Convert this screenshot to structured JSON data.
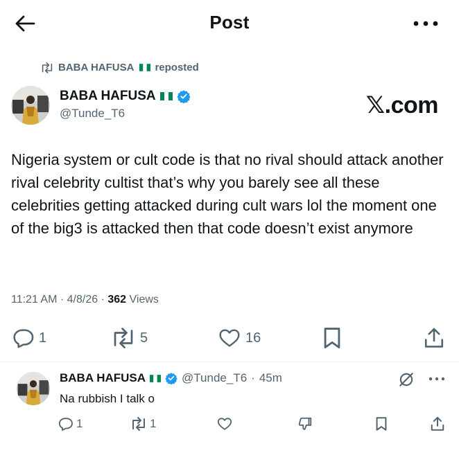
{
  "header": {
    "title": "Post"
  },
  "repost": {
    "label": "BABA HAFUSA",
    "suffix": "reposted"
  },
  "post": {
    "author_name": "BABA HAFUSA",
    "author_handle": "@Tunde_T6",
    "brand": "𝕏.com",
    "text": "Nigeria system or cult code is that no rival should attack another rival celebrity cultist that’s why you barely see all these celebrities getting attacked during cult wars lol the moment one of the big3 is attacked then that code doesn’t exist anymore",
    "time": "11:21 AM",
    "date": "4/8/26",
    "views_count": "362",
    "views_label": "Views",
    "replies": "1",
    "reposts": "5",
    "likes": "16"
  },
  "reply": {
    "author_name": "BABA HAFUSA",
    "author_handle": "@Tunde_T6",
    "age": "45m",
    "text": "Na rubbish I talk o",
    "replies": "1",
    "reposts": "1"
  },
  "colors": {
    "text": "#0f1419",
    "muted": "#536471",
    "verified": "#1d9bf0",
    "flag_green": "#008751"
  },
  "icons": [
    "back-arrow-icon",
    "more-icon",
    "repost-icon",
    "verified-icon",
    "nigeria-flag-icon",
    "reply-icon",
    "like-icon",
    "dislike-icon",
    "bookmark-icon",
    "share-icon",
    "grok-icon"
  ]
}
